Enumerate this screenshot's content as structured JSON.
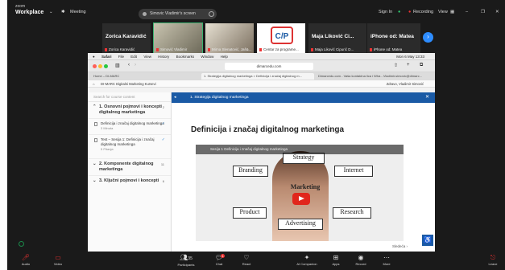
{
  "zoom": {
    "brand_line1": "zoom",
    "brand_line2": "Workplace",
    "meeting_label": "Meeting",
    "share_pill": "Simovic Vladimir's screen",
    "signin": "Sign In",
    "recording": "Recording",
    "view": "View",
    "participants_count": "35",
    "chat_badge": "1",
    "colors": {
      "accent": "#2d8cff",
      "recording": "#e33",
      "bg": "#1a1a1a"
    }
  },
  "tiles": [
    {
      "name": "Zorica Karavidić",
      "sub": "Zorica Karavidić",
      "bg": "#2b2b2b"
    },
    {
      "name": "",
      "sub": "Simović Vladimir",
      "bg": "#8a8471"
    },
    {
      "name": "",
      "sub": "Mirna Slenatović, Jaš&...",
      "bg": "#7c7060"
    },
    {
      "name": "",
      "sub": "Centar za programe...",
      "bg": "#ffffff"
    },
    {
      "name": "Maja Liković Ci...",
      "sub": "Maja Liković Cipurić D...",
      "bg": "#2b2b2b"
    },
    {
      "name": "iPhone od: Matea",
      "sub": "iPhone od: Matea",
      "bg": "#2b2b2b"
    }
  ],
  "mac": {
    "menu": [
      "Safari",
      "File",
      "Edit",
      "View",
      "History",
      "Bookmarks",
      "Window",
      "Help"
    ],
    "clock": "Mon 6 May 13:33",
    "url": "dimarcedu.com",
    "tabs": [
      "Home – DI-MARC",
      "1. Strategija digitalnog marketinga > Definicija i značaj digitalnog m...",
      "Dimarcedu.com - Vaša kontaktna lica i Wha - Vladimir.simovic@dimarc..."
    ]
  },
  "lms": {
    "title": "DI-MARC Digitalni Marketing Kursevi",
    "user": "Zdravo, Vladimir Simović",
    "search_placeholder": "Search for course content",
    "sections": [
      {
        "label": "1. Osnovni pojmovi i koncepti digitalnog marketinga",
        "count": "2"
      },
      {
        "label": "2. Komponente digitalnog marketinga",
        "count": "11"
      },
      {
        "label": "3. Ključni pojmovi i koncepti",
        "count": "6"
      }
    ],
    "items": [
      {
        "title": "Definicija i značaj digitalnog marketinga",
        "meta": "3 Minuta"
      },
      {
        "title": "Test – Sesija 1: Definicija i značaj digitalnog marketinga",
        "meta": "5 Pitanja"
      }
    ],
    "lesson_bar": "1. Strategija digitalnog marketinga",
    "heading": "Definicija i značaj digitalnog marketinga",
    "video_title": "Sesija 1 Definicija i značaj digitalnog marketinga",
    "video_words": [
      "Strategy",
      "Branding",
      "Internet",
      "Marketing",
      "Product",
      "Research",
      "Advertising"
    ],
    "next": "Sledeća",
    "colors": {
      "primary": "#1a5aa5",
      "play": "#e1261c"
    }
  },
  "toolbar": [
    {
      "label": "Audio",
      "icon": "mic-muted-icon"
    },
    {
      "label": "Video",
      "icon": "camera-off-icon"
    },
    {
      "label": "Participants",
      "icon": "participants-icon"
    },
    {
      "label": "Chat",
      "icon": "chat-icon"
    },
    {
      "label": "React",
      "icon": "heart-icon"
    },
    {
      "label": "AI Companion",
      "icon": "sparkle-icon"
    },
    {
      "label": "Apps",
      "icon": "apps-icon"
    },
    {
      "label": "Record",
      "icon": "record-icon"
    },
    {
      "label": "More",
      "icon": "more-icon"
    },
    {
      "label": "Leave",
      "icon": "leave-icon"
    }
  ]
}
